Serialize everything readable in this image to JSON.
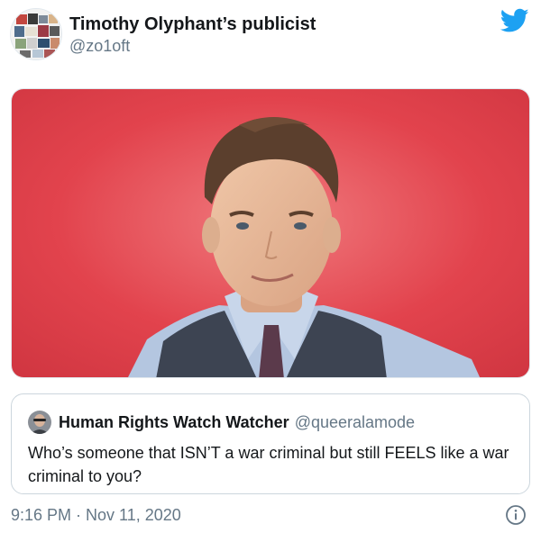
{
  "author": {
    "display_name": "Timothy Olyphant’s publicist",
    "handle": "@zo1oft"
  },
  "icons": {
    "brand": "twitter-bird-icon",
    "info": "info-icon"
  },
  "colors": {
    "twitter_blue": "#1da1f2",
    "photo_background": "#e2434d",
    "secondary_text": "#657786"
  },
  "quoted_tweet": {
    "display_name": "Human Rights Watch Watcher",
    "handle": "@queeralamode",
    "text": "Who’s someone that ISN’T a war criminal but still FEELS like a war criminal to you?"
  },
  "timestamp": "9:16 PM · Nov 11, 2020"
}
